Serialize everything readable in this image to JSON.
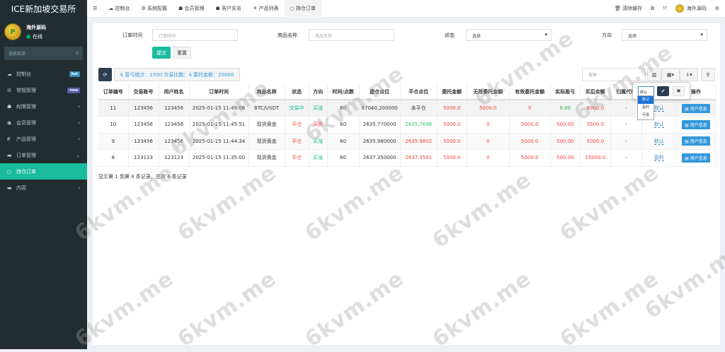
{
  "app": {
    "title": "ICE新加坡交易所"
  },
  "user": {
    "name": "海外源码",
    "status": "在线"
  },
  "sidebar": {
    "search_placeholder": "搜索菜单",
    "items": [
      {
        "label": "控制台",
        "badge": "hot",
        "badge_color": "#3c8dbc",
        "icon": "dashboard-icon"
      },
      {
        "label": "常规管理",
        "badge": "new",
        "badge_color": "#605ca8",
        "icon": "cogs-icon"
      },
      {
        "label": "权限管理",
        "icon": "group-icon",
        "chevron": "‹"
      },
      {
        "label": "会员管理",
        "icon": "user-circle-icon",
        "chevron": "‹"
      },
      {
        "label": "产品管理",
        "icon": "product-icon",
        "chevron": "‹"
      },
      {
        "label": "订单管理",
        "icon": "list-icon",
        "chevron": "⌄"
      },
      {
        "label": "持仓订单",
        "icon": "circle-icon",
        "active": true
      },
      {
        "label": "内容",
        "icon": "list-icon",
        "chevron": "‹"
      }
    ]
  },
  "topbar": {
    "tabs": [
      "控制台",
      "系统配置",
      "会员管理",
      "客户实名",
      "产品列表",
      "持仓订单"
    ],
    "clear_cache": "清除缓存",
    "username": "海外源码"
  },
  "filters": {
    "order_time_label": "订单时间",
    "order_time_placeholder": "订单时间",
    "product_label": "商品名称",
    "product_placeholder": "商品名称",
    "status_label": "状态",
    "status_value": "选择",
    "direction_label": "方向",
    "direction_value": "选择",
    "submit": "提交",
    "reset": "重置"
  },
  "toolbar": {
    "stats": "$ 盈亏统计：1500 交易比数：4 委托金额：20000",
    "search_placeholder": "搜索"
  },
  "table": {
    "headers": [
      "订单编号",
      "交易账号",
      "用户姓名",
      "订单时间",
      "商品名称",
      "状态",
      "方向",
      "时间/点数",
      "建仓点位",
      "平仓点位",
      "委托金额",
      "无效委托金额",
      "有效委托金额",
      "实际盈亏",
      "买后余额",
      "归属代理",
      "",
      "操作"
    ],
    "rows": [
      [
        "11",
        "123456",
        "123456",
        "2025-01-15 11:49:06",
        "BTC/USDT",
        "交易中",
        "买涨",
        "60",
        "97040.200000",
        "未平仓",
        "5000.0",
        "5000.0",
        "0",
        "0.00",
        "6000.0",
        "-",
        "默认",
        "用户信息"
      ],
      [
        "10",
        "123456",
        "123456",
        "2025-01-15 11:45:51",
        "现货黄金",
        "平仓",
        "买跌",
        "60",
        "2635.770000",
        "2635.7698",
        "5000.0",
        "0",
        "5000.0",
        "500.00",
        "5500.0",
        "-",
        "默认",
        "用户信息"
      ],
      [
        "9",
        "123456",
        "123456",
        "2025-01-15 11:44:34",
        "现货黄金",
        "平仓",
        "买涨",
        "60",
        "2635.980000",
        "2635.9802",
        "5000.0",
        "0",
        "5000.0",
        "500.00",
        "5000.0",
        "-",
        "默认",
        "用户信息"
      ],
      [
        "8",
        "123123",
        "123123",
        "2025-01-15 11:35:00",
        "现货黄金",
        "平仓",
        "买涨",
        "60",
        "2637.350000",
        "2637.3501",
        "5000.0",
        "0",
        "5000.0",
        "500.00",
        "15000.0",
        "-",
        "盈利",
        "用户信息"
      ]
    ],
    "footer": "显示第 1 到第 4 条记录，总共 4 条记录"
  },
  "editable_popover": {
    "selected": "默认",
    "options": [
      "默认",
      "盈利",
      "亏损"
    ]
  },
  "watermark": "6kvm.me"
}
